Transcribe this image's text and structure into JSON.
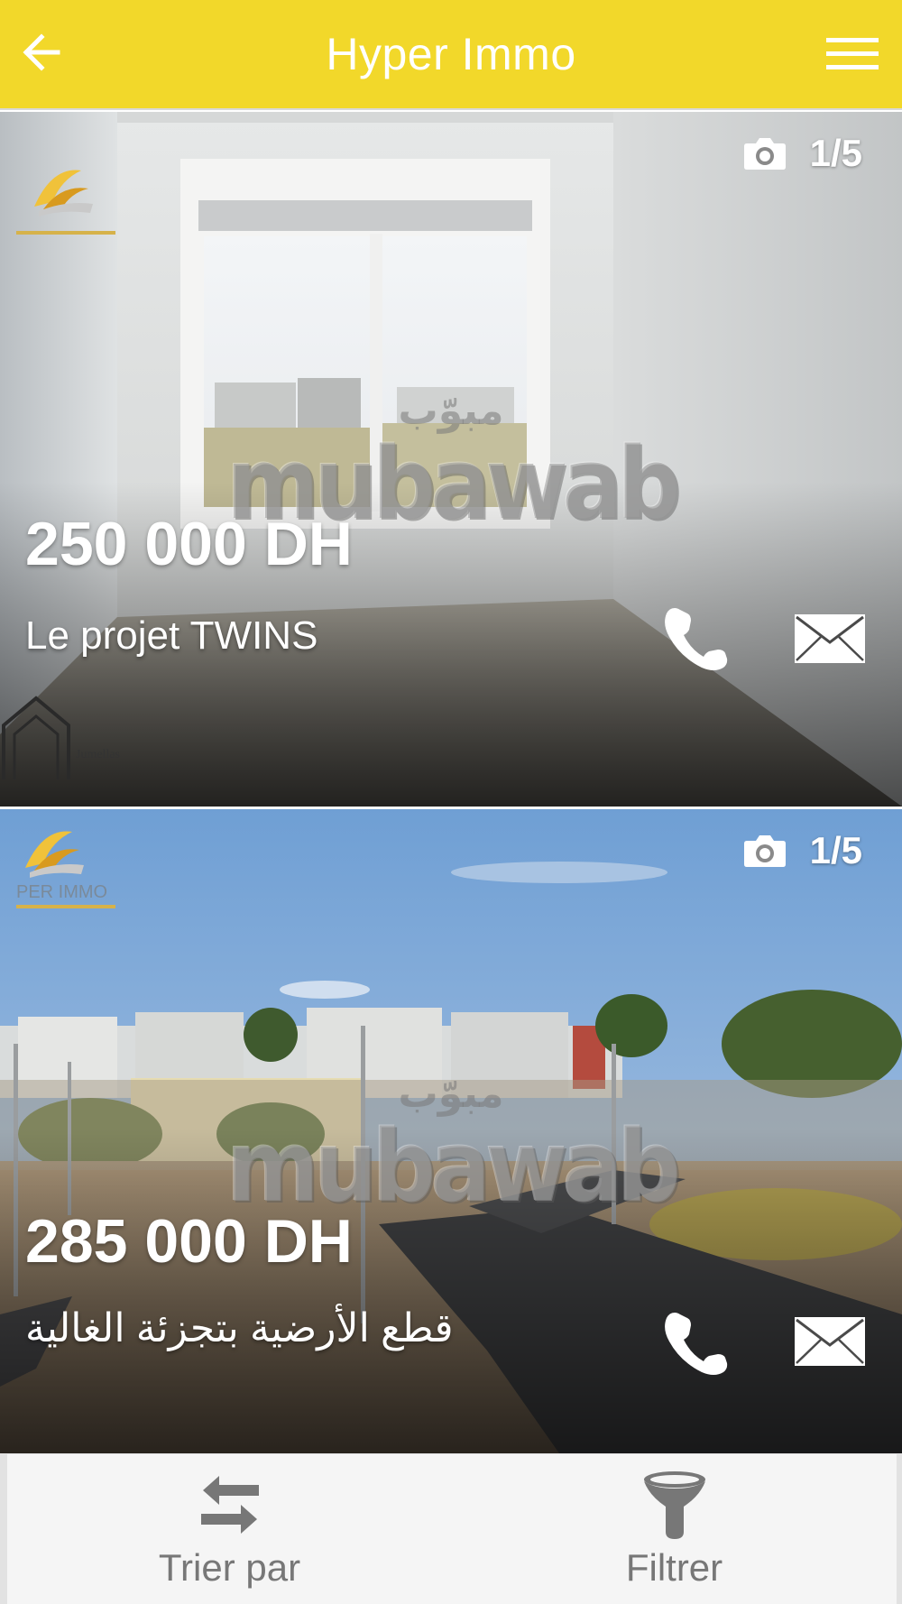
{
  "header": {
    "title": "Hyper Immo",
    "back_icon": "arrow-left-icon",
    "menu_icon": "hamburger-menu-icon",
    "background": "#f2d82a"
  },
  "listings": [
    {
      "photo_counter": "1/5",
      "watermark_arabic": "مبوّب",
      "watermark_latin": "mubawab",
      "price": "250 000 DH",
      "title": "Le projet TWINS"
    },
    {
      "photo_counter": "1/5",
      "watermark_arabic": "مبوّب",
      "watermark_latin": "mubawab",
      "price": "285 000 DH",
      "title": "قطع الأرضية بتجزئة الغالية"
    }
  ],
  "bottom_bar": {
    "sort_label": "Trier par",
    "filter_label": "Filtrer"
  }
}
